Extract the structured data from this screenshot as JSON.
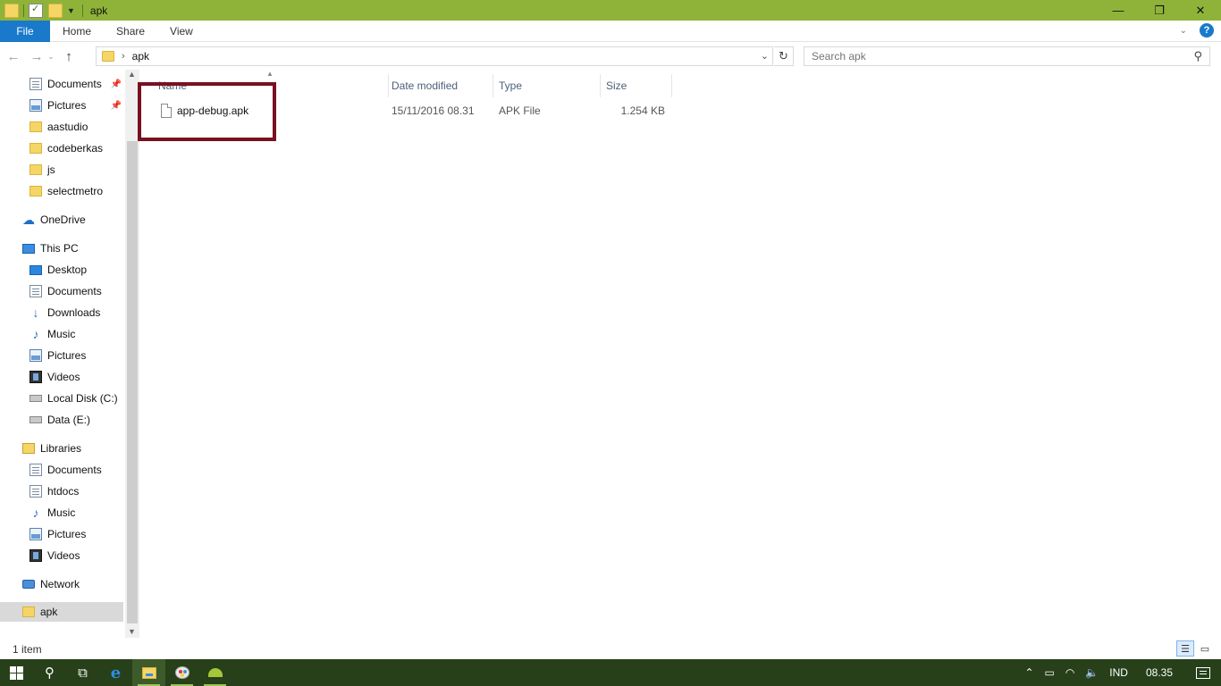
{
  "window": {
    "title": "apk",
    "controls": {
      "minimize": "—",
      "maximize": "❐",
      "close": "✕"
    }
  },
  "ribbon": {
    "tabs": [
      {
        "label": "File"
      },
      {
        "label": "Home"
      },
      {
        "label": "Share"
      },
      {
        "label": "View"
      }
    ],
    "help_label": "?"
  },
  "address": {
    "path": [
      "apk"
    ],
    "search_placeholder": "Search apk"
  },
  "nav_pane": {
    "quick_access": [
      {
        "label": "Documents",
        "icon": "documents-icon",
        "pinned": true
      },
      {
        "label": "Pictures",
        "icon": "pictures-icon",
        "pinned": true
      },
      {
        "label": "aastudio",
        "icon": "folder-icon"
      },
      {
        "label": "codeberkas",
        "icon": "folder-icon"
      },
      {
        "label": "js",
        "icon": "folder-icon"
      },
      {
        "label": "selectmetro",
        "icon": "folder-icon"
      }
    ],
    "onedrive": {
      "label": "OneDrive"
    },
    "this_pc": {
      "label": "This PC",
      "items": [
        {
          "label": "Desktop"
        },
        {
          "label": "Documents"
        },
        {
          "label": "Downloads"
        },
        {
          "label": "Music"
        },
        {
          "label": "Pictures"
        },
        {
          "label": "Videos"
        },
        {
          "label": "Local Disk (C:)"
        },
        {
          "label": "Data (E:)"
        }
      ]
    },
    "libraries": {
      "label": "Libraries",
      "items": [
        {
          "label": "Documents"
        },
        {
          "label": "htdocs"
        },
        {
          "label": "Music"
        },
        {
          "label": "Pictures"
        },
        {
          "label": "Videos"
        }
      ]
    },
    "network": {
      "label": "Network"
    },
    "selected": {
      "label": "apk"
    }
  },
  "file_list": {
    "columns": [
      "Name",
      "Date modified",
      "Type",
      "Size"
    ],
    "rows": [
      {
        "name": "app-debug.apk",
        "date_modified": "15/11/2016 08.31",
        "type": "APK File",
        "size": "1.254 KB"
      }
    ],
    "highlight_color": "#7a1020"
  },
  "status": {
    "item_count": "1 item"
  },
  "taskbar": {
    "tray": {
      "language": "IND",
      "time": "08.35"
    }
  },
  "colors": {
    "title_bar": "#8fb339",
    "file_tab": "#1979ca",
    "taskbar": "#27401a"
  }
}
